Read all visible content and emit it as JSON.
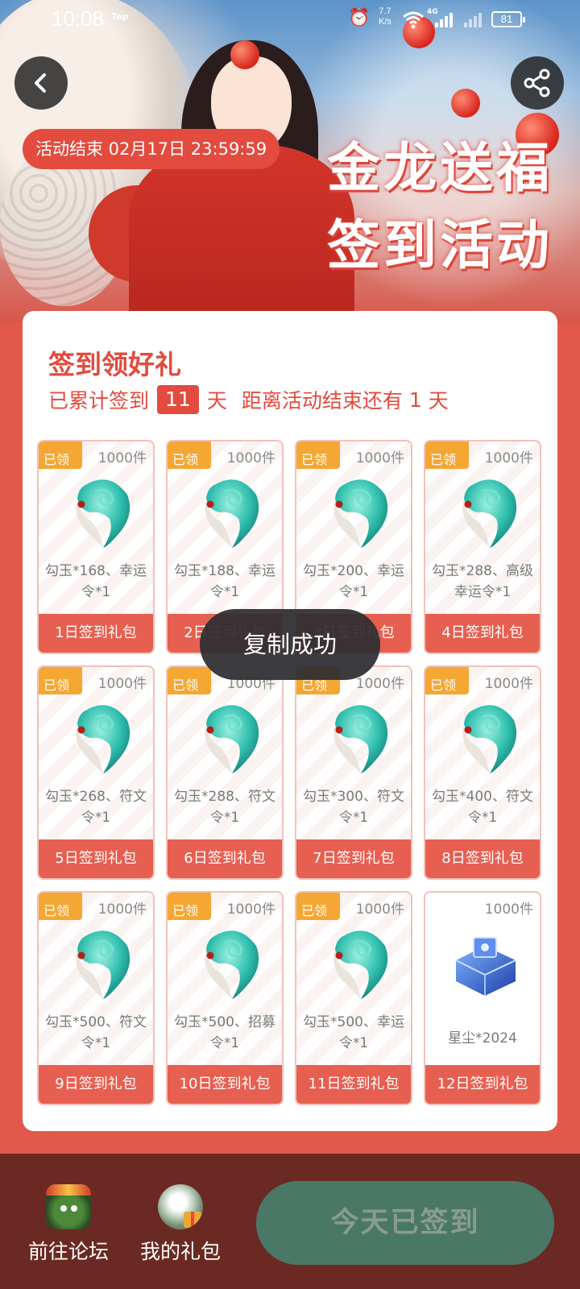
{
  "status_bar": {
    "time": "10:08",
    "small_label": "Tap",
    "net_speed_value": "7.7",
    "net_speed_unit": "K/s",
    "signal_label": "4G",
    "battery": "81"
  },
  "banner": {
    "title_line1": "金龙送福",
    "title_line2": "签到活动",
    "end_time": "活动结束 02月17日 23:59:59"
  },
  "card": {
    "title": "签到领好礼",
    "progress_prefix": "已累计签到",
    "signed_days": "11",
    "days_unit": "天",
    "remaining_prefix": "距离活动结束还有",
    "remaining_days": "1",
    "remaining_unit": "天"
  },
  "gifts": [
    {
      "stock": "1000件",
      "desc": "勾玉*168、幸运令*1",
      "button": "1日签到礼包",
      "claimed": true,
      "claimed_label": "已领",
      "icon": "jade-icon"
    },
    {
      "stock": "1000件",
      "desc": "勾玉*188、幸运令*1",
      "button": "2日签到礼包",
      "claimed": true,
      "claimed_label": "已领",
      "icon": "jade-icon"
    },
    {
      "stock": "1000件",
      "desc": "勾玉*200、幸运令*1",
      "button": "3日签到礼包",
      "claimed": true,
      "claimed_label": "已领",
      "icon": "jade-icon"
    },
    {
      "stock": "1000件",
      "desc": "勾玉*288、高级幸运令*1",
      "button": "4日签到礼包",
      "claimed": true,
      "claimed_label": "已领",
      "icon": "jade-icon"
    },
    {
      "stock": "1000件",
      "desc": "勾玉*268、符文令*1",
      "button": "5日签到礼包",
      "claimed": true,
      "claimed_label": "已领",
      "icon": "jade-icon"
    },
    {
      "stock": "1000件",
      "desc": "勾玉*288、符文令*1",
      "button": "6日签到礼包",
      "claimed": true,
      "claimed_label": "已领",
      "icon": "jade-icon"
    },
    {
      "stock": "1000件",
      "desc": "勾玉*300、符文令*1",
      "button": "7日签到礼包",
      "claimed": true,
      "claimed_label": "已领",
      "icon": "jade-icon"
    },
    {
      "stock": "1000件",
      "desc": "勾玉*400、符文令*1",
      "button": "8日签到礼包",
      "claimed": true,
      "claimed_label": "已领",
      "icon": "jade-icon"
    },
    {
      "stock": "1000件",
      "desc": "勾玉*500、符文令*1",
      "button": "9日签到礼包",
      "claimed": true,
      "claimed_label": "已领",
      "icon": "jade-icon"
    },
    {
      "stock": "1000件",
      "desc": "勾玉*500、招募令*1",
      "button": "10日签到礼包",
      "claimed": true,
      "claimed_label": "已领",
      "icon": "jade-icon"
    },
    {
      "stock": "1000件",
      "desc": "勾玉*500、幸运令*1",
      "button": "11日签到礼包",
      "claimed": true,
      "claimed_label": "已领",
      "icon": "jade-icon"
    },
    {
      "stock": "1000件",
      "desc": "星尘*2024",
      "button": "12日签到礼包",
      "claimed": false,
      "claimed_label": "",
      "icon": "stardust-icon"
    }
  ],
  "toast": "复制成功",
  "bottom_bar": {
    "forum_label": "前往论坛",
    "gifts_label": "我的礼包",
    "signed_button": "今天已签到"
  },
  "colors": {
    "accent": "#e24b3e",
    "claimed_tag": "#f4a733",
    "bottom_bar": "#6b2923",
    "signed_button": "#4a7867"
  }
}
